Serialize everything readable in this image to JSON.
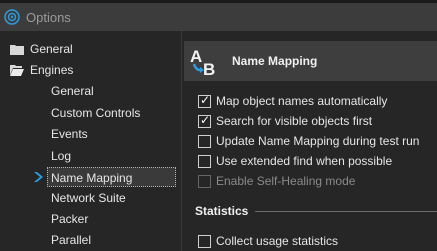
{
  "window": {
    "title": "Options"
  },
  "tree": {
    "items": [
      {
        "label": "General",
        "level": 0,
        "folder": "closed"
      },
      {
        "label": "Engines",
        "level": 0,
        "folder": "open"
      },
      {
        "label": "General",
        "level": 1
      },
      {
        "label": "Custom Controls",
        "level": 1
      },
      {
        "label": "Events",
        "level": 1
      },
      {
        "label": "Log",
        "level": 1
      },
      {
        "label": "Name Mapping",
        "level": 1,
        "selected": true
      },
      {
        "label": "Network Suite",
        "level": 1
      },
      {
        "label": "Packer",
        "level": 1
      },
      {
        "label": "Parallel",
        "level": 1
      }
    ]
  },
  "panel": {
    "title": "Name Mapping",
    "icon": "ab-name-mapping-icon",
    "options": [
      {
        "label": "Map object names automatically",
        "checked": true,
        "enabled": true
      },
      {
        "label": "Search for visible objects first",
        "checked": true,
        "enabled": true
      },
      {
        "label": "Update Name Mapping during test run",
        "checked": false,
        "enabled": true
      },
      {
        "label": "Use extended find when possible",
        "checked": false,
        "enabled": true
      },
      {
        "label": "Enable Self-Healing mode",
        "checked": false,
        "enabled": false
      }
    ],
    "statistics": {
      "title": "Statistics",
      "options": [
        {
          "label": "Collect usage statistics",
          "checked": false,
          "enabled": true
        }
      ]
    }
  },
  "colors": {
    "accent": "#2e9bdc",
    "background": "#262626",
    "header": "#3e3e3e"
  }
}
